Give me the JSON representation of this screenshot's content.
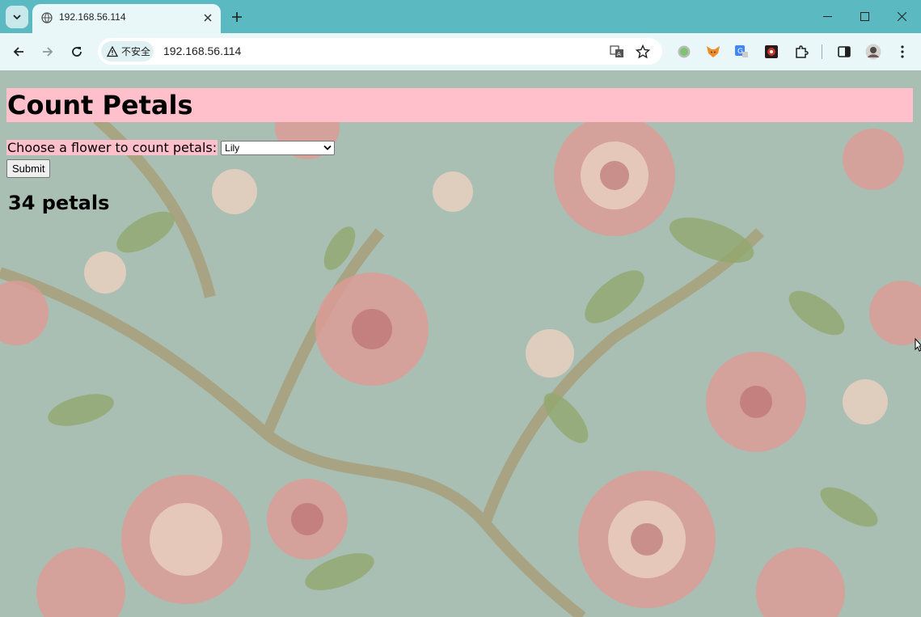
{
  "browser": {
    "tab_title": "192.168.56.114",
    "security_chip": "不安全",
    "url": "192.168.56.114",
    "frame_color": "#5bb9c2",
    "toolbar_color": "#e9f7f8"
  },
  "page": {
    "heading": "Count Petals",
    "form": {
      "label": "Choose a flower to count petals:",
      "selected_flower": "Lily",
      "submit_label": "Submit"
    },
    "result": "34 petals",
    "heading_background": "#ffc0cb"
  },
  "icons": {
    "extensions": [
      "green-circle-icon",
      "fox-extension-icon",
      "google-translate-extension-icon",
      "dark-extension-icon",
      "puzzle-icon"
    ]
  }
}
